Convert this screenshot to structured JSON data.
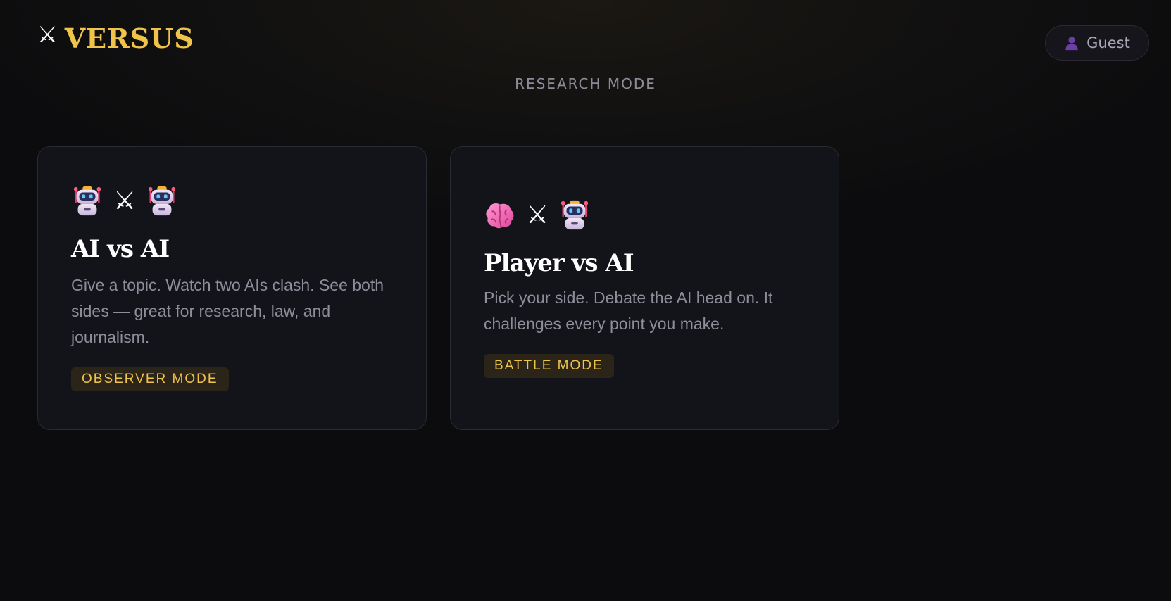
{
  "header": {
    "logo_icon": "⚔",
    "logo_text": "VERSUS",
    "user_icon": "person-icon",
    "user_label": "Guest"
  },
  "subtitle": "RESEARCH MODE",
  "colors": {
    "accent": "#f0c44a",
    "background": "#0c0c0e",
    "card_background": "#13131a",
    "muted_text": "#8f8d9a"
  },
  "cards": [
    {
      "icons": [
        "robot-icon",
        "crossed-swords-icon",
        "robot-icon"
      ],
      "swords": "⚔",
      "title": "AI vs AI",
      "description": "Give a topic. Watch two AIs clash. See both sides — great for research, law, and journalism.",
      "badge": "OBSERVER MODE"
    },
    {
      "icons": [
        "brain-icon",
        "crossed-swords-icon",
        "robot-icon"
      ],
      "swords": "⚔",
      "title": "Player vs AI",
      "description": "Pick your side. Debate the AI head on. It challenges every point you make.",
      "badge": "BATTLE MODE"
    }
  ]
}
